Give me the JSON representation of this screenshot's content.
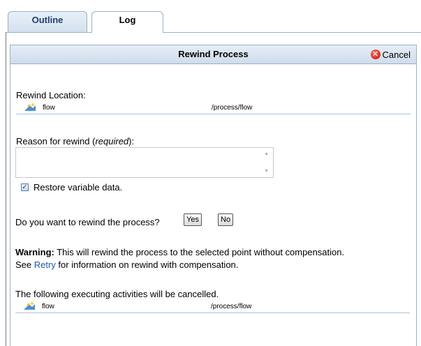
{
  "tabs": [
    {
      "label": "Outline"
    },
    {
      "label": "Log"
    }
  ],
  "dialog": {
    "title": "Rewind Process",
    "cancel_label": "Cancel",
    "rewind_location_label": "Rewind Location:",
    "location_item": {
      "name": "flow",
      "path": "/process/flow"
    },
    "reason_label_prefix": "Reason for rewind (",
    "reason_label_required": "required",
    "reason_label_suffix": "):",
    "reason_value": "",
    "restore_checkbox_checked": true,
    "restore_label": "Restore variable data.",
    "question": "Do you want to rewind the process?",
    "yes_label": "Yes",
    "no_label": "No",
    "warning_bold": "Warning:",
    "warning_text": " This will rewind the process to the selected point without compensation.",
    "see_prefix": "See ",
    "retry_link": "Retry",
    "see_suffix": " for information on rewind with compensation.",
    "cancelled_label": "The following executing activities will be cancelled.",
    "cancelled_item": {
      "name": "flow",
      "path": "/process/flow"
    }
  }
}
